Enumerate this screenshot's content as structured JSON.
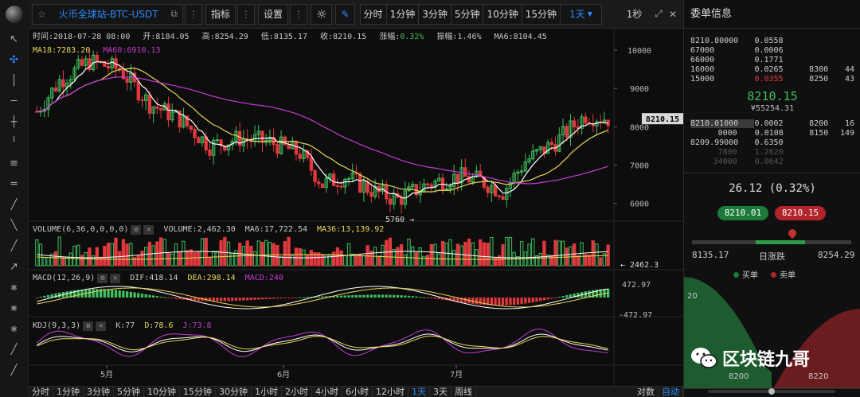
{
  "toolbar": {
    "symbol": "火币全球站-BTC-USDT",
    "indicators": "指标",
    "settings": "设置",
    "periods": [
      "分时",
      "1分钟",
      "3分钟",
      "5分钟",
      "10分钟",
      "15分钟"
    ],
    "active_period": "1天",
    "refresh": "1秒",
    "accent": "#2b8cff"
  },
  "info": {
    "time": "时间:2018-07-28 08:00",
    "open": "开:8184.05",
    "high": "高:8254.29",
    "low": "低:8135.17",
    "close": "收:8210.15",
    "change_label": "涨幅:",
    "change_value": "0.32%",
    "amplitude": "振幅:1.46%",
    "ma6": "MA6:8104.45",
    "ma18": "MA18:7283.20",
    "ma60": "MA60:6910.13"
  },
  "volume_label": {
    "name": "VOLUME(6,36,0,0,0,0)",
    "value": "VOLUME:2,462.30",
    "ma6": "MA6:17,722.54",
    "ma36": "MA36:13,139.92"
  },
  "macd_label": {
    "name": "MACD(12,26,9)",
    "dif": "DIF:418.14",
    "dea": "DEA:298.14",
    "macd": "MACD:240"
  },
  "kdj_label": {
    "name": "KDJ(9,3,3)",
    "k": "K:77",
    "d": "D:78.6",
    "j": "J:73.8"
  },
  "price_axis": [
    "10000",
    "9000",
    "8000",
    "7000",
    "6000"
  ],
  "price_tag": "8210.15",
  "low_marker": "5760",
  "volume_tag": "2462.3",
  "macd_axis": [
    "472.97",
    "-472.97"
  ],
  "month_labels": [
    "5月",
    "6月",
    "7月"
  ],
  "bottom_periods": [
    "分时",
    "1分钟",
    "3分钟",
    "5分钟",
    "10分钟",
    "15分钟",
    "30分钟",
    "1小时",
    "2小时",
    "4小时",
    "6小时",
    "12小时",
    "1天",
    "3天",
    "周线"
  ],
  "bottom_active": "1天",
  "bottom_right": [
    "对数",
    "自动"
  ],
  "colors": {
    "up": "#3fbf5f",
    "down": "#e0393e",
    "ma6": "#ffffff",
    "ma18": "#e8d85a",
    "ma60": "#c63ad6"
  },
  "chart_data": {
    "type": "candlestick",
    "ma_series": [
      "MA6",
      "MA18",
      "MA60"
    ],
    "y_ticks": [
      6000,
      7000,
      8000,
      9000,
      10000
    ],
    "last_close": 8210.15,
    "period_low": 5760,
    "x_labels": [
      "5月",
      "6月",
      "7月"
    ]
  },
  "book": {
    "title": "委单信息",
    "asks": [
      [
        "8210.80000",
        "0.0558",
        "",
        ""
      ],
      [
        "67000",
        "0.0006",
        "",
        ""
      ],
      [
        "66000",
        "0.1771",
        "",
        ""
      ],
      [
        "16000",
        "0.0265",
        "8300",
        "44"
      ],
      [
        "15000",
        "0.0355",
        "8250",
        "43"
      ]
    ],
    "last": "8210.15",
    "last_cny": "¥55254.31",
    "bids": [
      [
        "8210.01000",
        "0.0002",
        "8200",
        "16"
      ],
      [
        "0000",
        "0.0108",
        "8150",
        "149"
      ],
      [
        "8209.99000",
        "0.6350",
        "",
        ""
      ],
      [
        "7800",
        "1.2620",
        "",
        ""
      ],
      [
        "34000",
        "0.0642",
        "",
        ""
      ]
    ],
    "change": "26.12 (0.32%)",
    "bid_price": "8210.01",
    "ask_price": "8210.15",
    "range_low": "8135.17",
    "range_label": "日涨跌",
    "range_high": "8254.29",
    "range_position": 0.63,
    "legend_buy": "买单",
    "legend_sell": "卖单",
    "depth_y": "20",
    "depth_x": [
      "8200",
      "8220"
    ],
    "watermark": "区块链九哥"
  }
}
